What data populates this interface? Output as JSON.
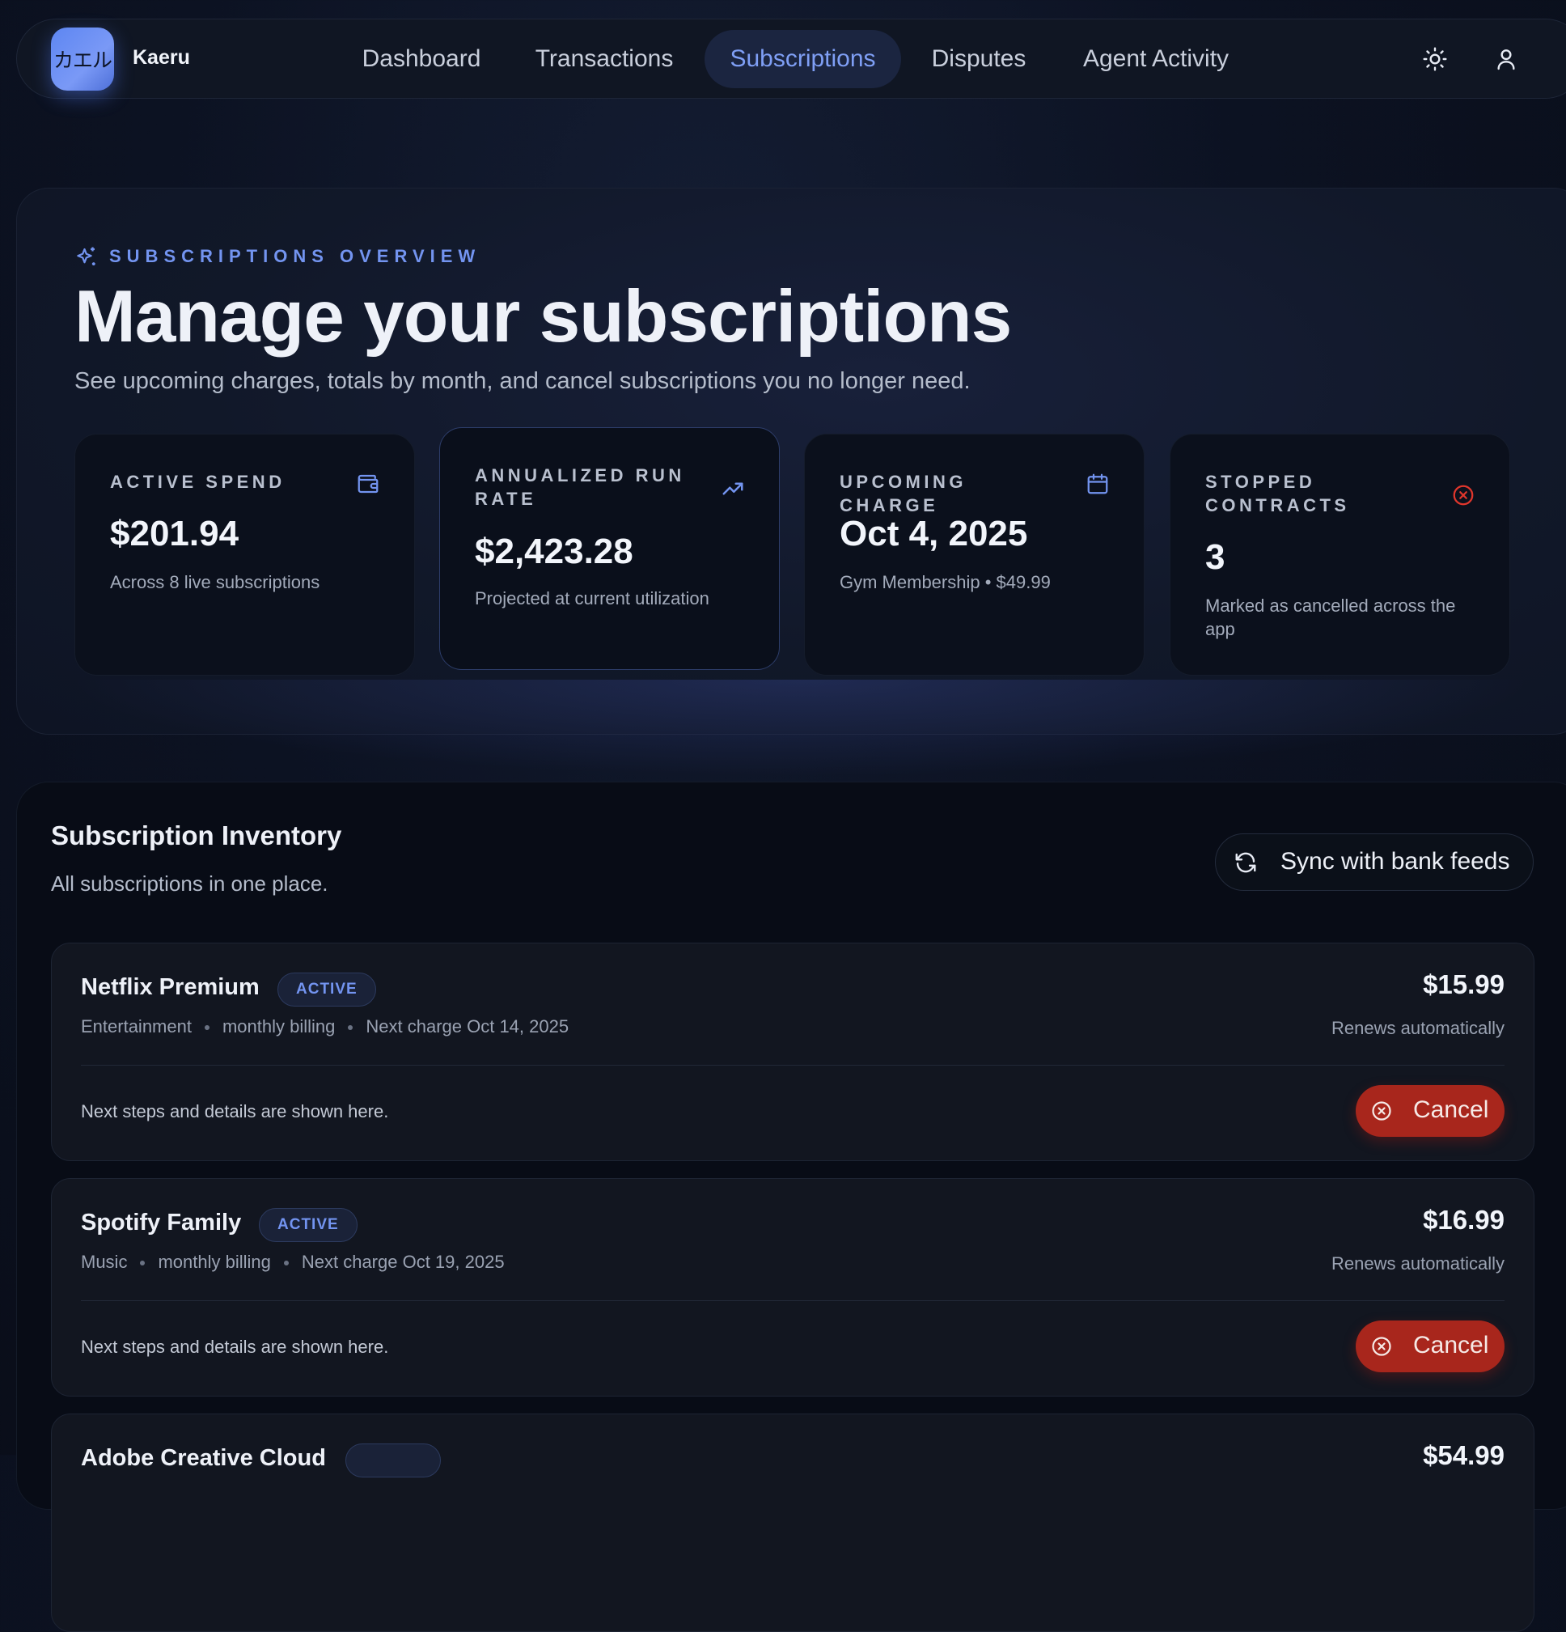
{
  "app": {
    "logo_text": "カエル",
    "brand": "Kaeru"
  },
  "nav": {
    "items": [
      {
        "label": "Dashboard"
      },
      {
        "label": "Transactions"
      },
      {
        "label": "Subscriptions",
        "active": true
      },
      {
        "label": "Disputes"
      },
      {
        "label": "Agent Activity"
      }
    ],
    "icons": [
      "sun-icon",
      "user-icon"
    ]
  },
  "hero": {
    "eyebrow": "SUBSCRIPTIONS OVERVIEW",
    "title": "Manage your subscriptions",
    "subtitle": "See upcoming charges, totals by month, and cancel subscriptions you no longer need."
  },
  "stats": [
    {
      "label": "ACTIVE SPEND",
      "value": "$201.94",
      "note": "Across 8 live subscriptions",
      "icon": "wallet-icon"
    },
    {
      "label": "ANNUALIZED RUN RATE",
      "value": "$2,423.28",
      "note": "Projected at current utilization",
      "icon": "trending-up-icon"
    },
    {
      "label": "UPCOMING CHARGE",
      "value": "Oct 4, 2025",
      "note": "Gym Membership • $49.99",
      "icon": "calendar-icon"
    },
    {
      "label": "STOPPED CONTRACTS",
      "value": "3",
      "note": "Marked as cancelled across the app",
      "icon": "circle-x-icon"
    }
  ],
  "inventory": {
    "title": "Subscription Inventory",
    "subtitle": "All subscriptions in one place.",
    "sync_label": "Sync with bank feeds"
  },
  "subscriptions": [
    {
      "name": "Netflix Premium",
      "status": "ACTIVE",
      "category": "Entertainment",
      "billing": "monthly billing",
      "next_charge": "Next charge Oct 14, 2025",
      "price": "$15.99",
      "renewal": "Renews automatically",
      "details": "Next steps and details are shown here.",
      "action": "Cancel"
    },
    {
      "name": "Spotify Family",
      "status": "ACTIVE",
      "category": "Music",
      "billing": "monthly billing",
      "next_charge": "Next charge Oct 19, 2025",
      "price": "$16.99",
      "renewal": "Renews automatically",
      "details": "Next steps and details are shown here.",
      "action": "Cancel"
    },
    {
      "name": "Adobe Creative Cloud",
      "price": "$54.99"
    }
  ],
  "colors": {
    "accent": "#7394f0",
    "danger": "#a8261c",
    "background": "#0c1222"
  }
}
